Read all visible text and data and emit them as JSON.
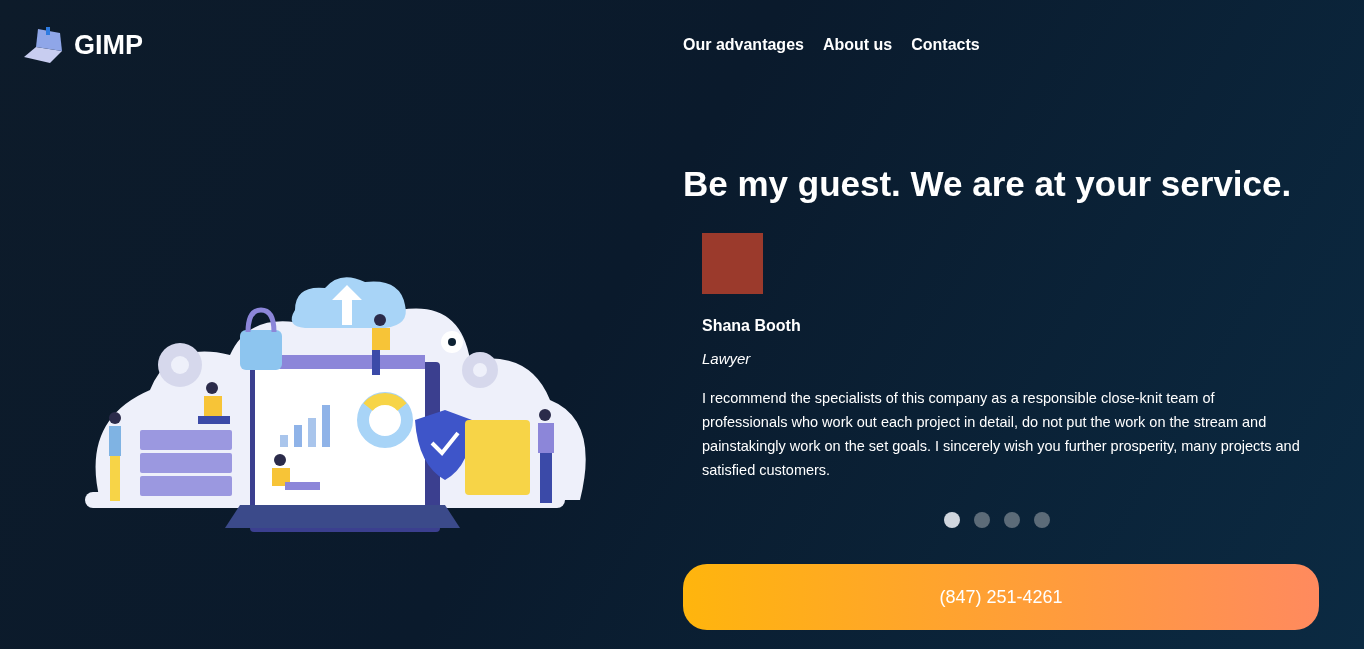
{
  "header": {
    "logo_text": "GIMP",
    "nav": [
      "Our advantages",
      "About us",
      "Contacts"
    ]
  },
  "hero": {
    "heading": "Be my guest. We are at your service."
  },
  "testimonial": {
    "name": "Shana Booth",
    "role": "Lawyer",
    "quote": "I recommend the specialists of this company as a responsible close-knit team of professionals who work out each project in detail, do not put the work on the stream and painstakingly work on the set goals. I sincerely wish you further prosperity, many projects and satisfied customers."
  },
  "slider_dots": [
    {
      "selected": true
    },
    {
      "selected": false
    },
    {
      "selected": false
    },
    {
      "selected": false
    }
  ],
  "phone_button": "(847) 251-4261"
}
